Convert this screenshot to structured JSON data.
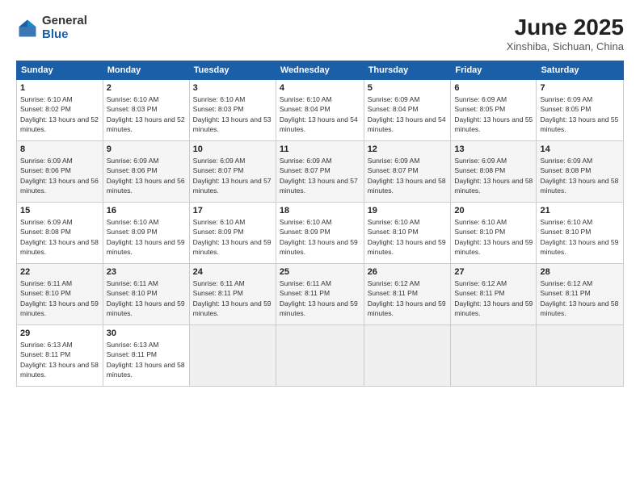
{
  "logo": {
    "general": "General",
    "blue": "Blue"
  },
  "title": {
    "month_year": "June 2025",
    "location": "Xinshiba, Sichuan, China"
  },
  "weekdays": [
    "Sunday",
    "Monday",
    "Tuesday",
    "Wednesday",
    "Thursday",
    "Friday",
    "Saturday"
  ],
  "weeks": [
    [
      {
        "day": "1",
        "sunrise": "6:10 AM",
        "sunset": "8:02 PM",
        "daylight": "13 hours and 52 minutes."
      },
      {
        "day": "2",
        "sunrise": "6:10 AM",
        "sunset": "8:03 PM",
        "daylight": "13 hours and 52 minutes."
      },
      {
        "day": "3",
        "sunrise": "6:10 AM",
        "sunset": "8:03 PM",
        "daylight": "13 hours and 53 minutes."
      },
      {
        "day": "4",
        "sunrise": "6:10 AM",
        "sunset": "8:04 PM",
        "daylight": "13 hours and 54 minutes."
      },
      {
        "day": "5",
        "sunrise": "6:09 AM",
        "sunset": "8:04 PM",
        "daylight": "13 hours and 54 minutes."
      },
      {
        "day": "6",
        "sunrise": "6:09 AM",
        "sunset": "8:05 PM",
        "daylight": "13 hours and 55 minutes."
      },
      {
        "day": "7",
        "sunrise": "6:09 AM",
        "sunset": "8:05 PM",
        "daylight": "13 hours and 55 minutes."
      }
    ],
    [
      {
        "day": "8",
        "sunrise": "6:09 AM",
        "sunset": "8:06 PM",
        "daylight": "13 hours and 56 minutes."
      },
      {
        "day": "9",
        "sunrise": "6:09 AM",
        "sunset": "8:06 PM",
        "daylight": "13 hours and 56 minutes."
      },
      {
        "day": "10",
        "sunrise": "6:09 AM",
        "sunset": "8:07 PM",
        "daylight": "13 hours and 57 minutes."
      },
      {
        "day": "11",
        "sunrise": "6:09 AM",
        "sunset": "8:07 PM",
        "daylight": "13 hours and 57 minutes."
      },
      {
        "day": "12",
        "sunrise": "6:09 AM",
        "sunset": "8:07 PM",
        "daylight": "13 hours and 58 minutes."
      },
      {
        "day": "13",
        "sunrise": "6:09 AM",
        "sunset": "8:08 PM",
        "daylight": "13 hours and 58 minutes."
      },
      {
        "day": "14",
        "sunrise": "6:09 AM",
        "sunset": "8:08 PM",
        "daylight": "13 hours and 58 minutes."
      }
    ],
    [
      {
        "day": "15",
        "sunrise": "6:09 AM",
        "sunset": "8:08 PM",
        "daylight": "13 hours and 58 minutes."
      },
      {
        "day": "16",
        "sunrise": "6:10 AM",
        "sunset": "8:09 PM",
        "daylight": "13 hours and 59 minutes."
      },
      {
        "day": "17",
        "sunrise": "6:10 AM",
        "sunset": "8:09 PM",
        "daylight": "13 hours and 59 minutes."
      },
      {
        "day": "18",
        "sunrise": "6:10 AM",
        "sunset": "8:09 PM",
        "daylight": "13 hours and 59 minutes."
      },
      {
        "day": "19",
        "sunrise": "6:10 AM",
        "sunset": "8:10 PM",
        "daylight": "13 hours and 59 minutes."
      },
      {
        "day": "20",
        "sunrise": "6:10 AM",
        "sunset": "8:10 PM",
        "daylight": "13 hours and 59 minutes."
      },
      {
        "day": "21",
        "sunrise": "6:10 AM",
        "sunset": "8:10 PM",
        "daylight": "13 hours and 59 minutes."
      }
    ],
    [
      {
        "day": "22",
        "sunrise": "6:11 AM",
        "sunset": "8:10 PM",
        "daylight": "13 hours and 59 minutes."
      },
      {
        "day": "23",
        "sunrise": "6:11 AM",
        "sunset": "8:10 PM",
        "daylight": "13 hours and 59 minutes."
      },
      {
        "day": "24",
        "sunrise": "6:11 AM",
        "sunset": "8:11 PM",
        "daylight": "13 hours and 59 minutes."
      },
      {
        "day": "25",
        "sunrise": "6:11 AM",
        "sunset": "8:11 PM",
        "daylight": "13 hours and 59 minutes."
      },
      {
        "day": "26",
        "sunrise": "6:12 AM",
        "sunset": "8:11 PM",
        "daylight": "13 hours and 59 minutes."
      },
      {
        "day": "27",
        "sunrise": "6:12 AM",
        "sunset": "8:11 PM",
        "daylight": "13 hours and 59 minutes."
      },
      {
        "day": "28",
        "sunrise": "6:12 AM",
        "sunset": "8:11 PM",
        "daylight": "13 hours and 58 minutes."
      }
    ],
    [
      {
        "day": "29",
        "sunrise": "6:13 AM",
        "sunset": "8:11 PM",
        "daylight": "13 hours and 58 minutes."
      },
      {
        "day": "30",
        "sunrise": "6:13 AM",
        "sunset": "8:11 PM",
        "daylight": "13 hours and 58 minutes."
      },
      null,
      null,
      null,
      null,
      null
    ]
  ]
}
